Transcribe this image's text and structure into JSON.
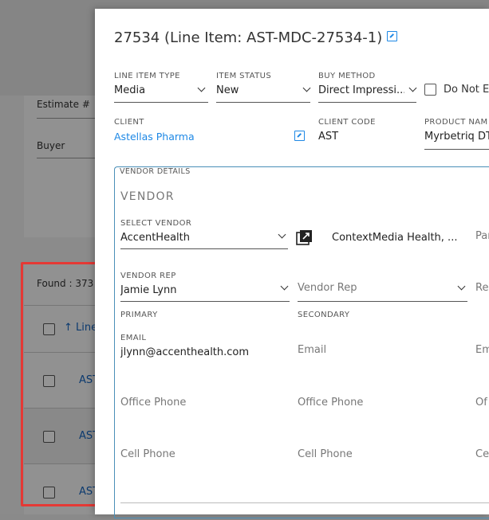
{
  "background": {
    "estimate_label": "Estimate #",
    "buyer_label": "Buyer",
    "found_text": "Found : 373",
    "header_col": "Line",
    "row_links": [
      "AST",
      "AST",
      "AST"
    ]
  },
  "modal": {
    "title": "27534 (Line Item: AST-MDC-27534-1)",
    "line_item_type": {
      "label": "LINE ITEM TYPE",
      "value": "Media"
    },
    "item_status": {
      "label": "ITEM STATUS",
      "value": "New"
    },
    "buy_method": {
      "label": "BUY METHOD",
      "value": "Direct Impressi..."
    },
    "do_not": {
      "label": "Do Not E"
    },
    "client": {
      "label": "CLIENT",
      "value": "Astellas Pharma"
    },
    "client_code": {
      "label": "CLIENT CODE",
      "value": "AST"
    },
    "product_name": {
      "label": "PRODUCT NAM",
      "value": "Myrbetriq DTC"
    },
    "vendor_details": {
      "label": "VENDOR DETAILS",
      "section_title": "VENDOR",
      "select_vendor": {
        "label": "SELECT VENDOR",
        "value": "AccentHealth"
      },
      "vendor_alt": "ContextMedia Health, ...",
      "partial_col": "Par",
      "vendor_rep": {
        "label": "VENDOR REP",
        "value": "Jamie Lynn"
      },
      "vendor_rep_placeholder": "Vendor Rep",
      "partial_rep": "Re",
      "primary_label": "PRIMARY",
      "secondary_label": "SECONDARY",
      "email_label": "EMAIL",
      "email_value": "jlynn@accenthealth.com",
      "email_placeholder": "Email",
      "email_partial": "Em",
      "office_phone": "Office Phone",
      "office_partial": "Of",
      "cell_phone": "Cell Phone",
      "cell_partial": "Ce"
    }
  },
  "colors": {
    "accent": "#1e88e5",
    "highlight": "#e53935"
  }
}
